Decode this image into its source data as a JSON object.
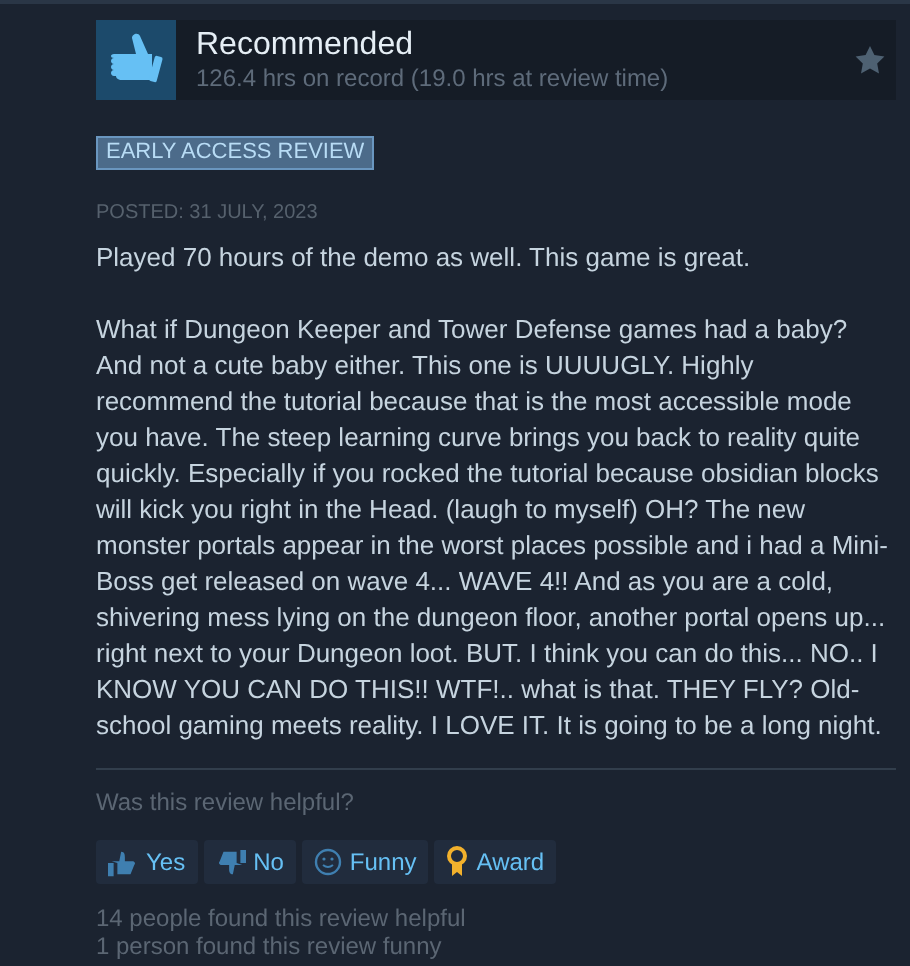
{
  "review": {
    "title": "Recommended",
    "hours": "126.4 hrs on record (19.0 hrs at review time)",
    "badge": "EARLY ACCESS REVIEW",
    "posted": "POSTED: 31 JULY, 2023",
    "paragraphs": [
      "Played 70 hours of the demo as well. This game is great.",
      "What if Dungeon Keeper and Tower Defense games had a baby? And not a cute baby either. This one is UUUUGLY. Highly recommend the tutorial because that is the most accessible mode you have. The steep learning curve brings you back to reality quite quickly. Especially if you rocked the tutorial because obsidian blocks will kick you right in the Head. (laugh to myself) OH? The new monster portals appear in the worst places possible and i had a Mini-Boss get released on wave 4... WAVE 4!! And as you are a cold, shivering mess lying on the dungeon floor, another portal opens up... right next to your Dungeon loot. BUT. I think you can do this... NO.. I KNOW YOU CAN DO THIS!! WTF!.. what is that. THEY FLY? Old-school gaming meets reality. I LOVE IT. It is going to be a long night."
    ]
  },
  "helpful": {
    "question": "Was this review helpful?",
    "buttons": [
      {
        "kind": "thumbs-up",
        "label": "Yes"
      },
      {
        "kind": "thumbs-down",
        "label": "No"
      },
      {
        "kind": "smiley",
        "label": "Funny"
      },
      {
        "kind": "award",
        "label": "Award"
      }
    ],
    "counts": [
      "14 people found this review helpful",
      "1 person found this review funny"
    ]
  }
}
